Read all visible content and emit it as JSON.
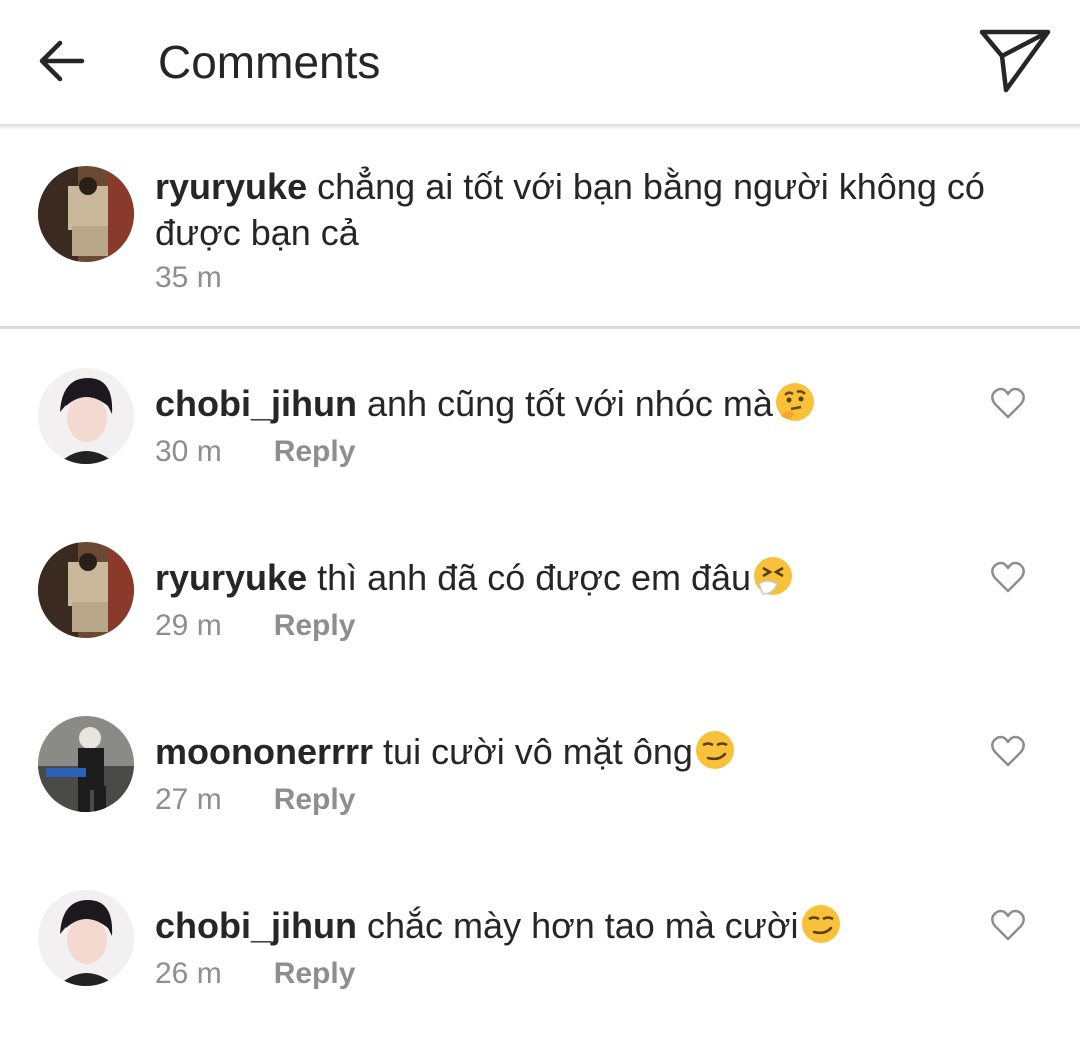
{
  "header": {
    "title": "Comments",
    "back_icon": "arrow-left-icon",
    "share_icon": "paper-plane-icon"
  },
  "caption": {
    "username": "ryuryuke",
    "text": "chẳng ai tốt với bạn bằng người không có được bạn cả",
    "time": "35 m"
  },
  "reply_label": "Reply",
  "comments": [
    {
      "username": "chobi_jihun",
      "text": "anh cũng tốt với nhóc mà",
      "emoji": "thinking-face",
      "time": "30 m"
    },
    {
      "username": "ryuryuke",
      "text": "thì anh đã có được em đâu",
      "emoji": "sneezing-face",
      "time": "29 m"
    },
    {
      "username": "moononerrrr",
      "text": "tui cười vô mặt ông",
      "emoji": "smirking-face",
      "time": "27 m"
    },
    {
      "username": "chobi_jihun",
      "text": "chắc mày hơn tao mà cười",
      "emoji": "smirking-face",
      "time": "26 m"
    }
  ],
  "colors": {
    "text": "#262626",
    "secondary": "#8e8e8e",
    "divider": "#dbdbdb"
  }
}
